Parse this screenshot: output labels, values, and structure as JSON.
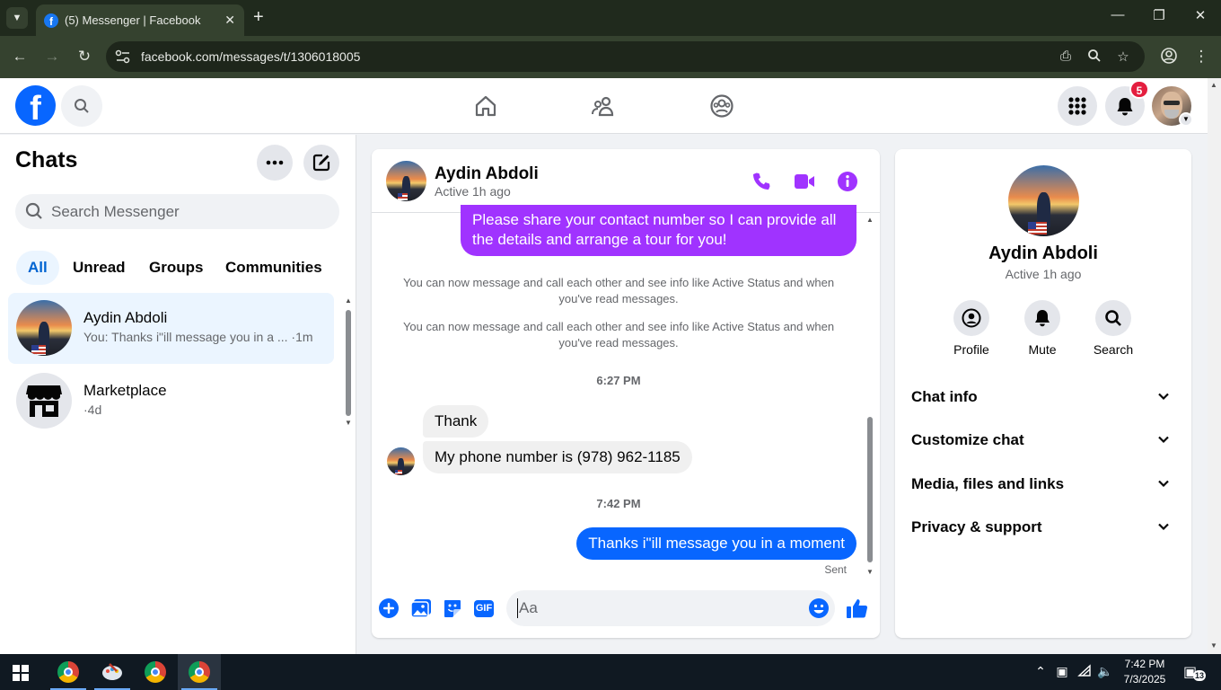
{
  "browser": {
    "tab_title": "(5) Messenger | Facebook",
    "url": "facebook.com/messages/t/1306018005"
  },
  "fb_header": {
    "notification_count": "5"
  },
  "left_panel": {
    "title": "Chats",
    "search_placeholder": "Search Messenger",
    "filters": [
      "All",
      "Unread",
      "Groups",
      "Communities"
    ],
    "chats": [
      {
        "name": "Aydin Abdoli",
        "preview": "You: Thanks i\"ill message you in a ... ·1m"
      },
      {
        "name": "Marketplace",
        "preview": "·4d"
      }
    ]
  },
  "conversation": {
    "name": "Aydin Abdoli",
    "status": "Active 1h ago",
    "messages": {
      "outgoing_1": "Please share your contact number so I can provide all the details and arrange a tour for you!",
      "system_1": "You can now message and call each other and see info like Active Status and when you've read messages.",
      "system_2": "You can now message and call each other and see info like Active Status and when you've read messages.",
      "time_1": "6:27 PM",
      "incoming_1": "Thank",
      "incoming_2": "My phone number is (978) 962-1185",
      "time_2": "7:42 PM",
      "outgoing_2": "Thanks i\"ill message you in a moment",
      "sent_label": "Sent"
    },
    "composer_placeholder": "Aa",
    "gif_label": "GIF"
  },
  "info_panel": {
    "name": "Aydin Abdoli",
    "status": "Active 1h ago",
    "actions": [
      "Profile",
      "Mute",
      "Search"
    ],
    "sections": [
      "Chat info",
      "Customize chat",
      "Media, files and links",
      "Privacy & support"
    ]
  },
  "taskbar": {
    "time": "7:42 PM",
    "date": "7/3/2025",
    "notification_count": "13"
  },
  "colors": {
    "fb_blue": "#0866ff",
    "purple_bubble": "#a033ff",
    "selected_row": "#ebf5ff",
    "badge_red": "#e41e3f"
  }
}
